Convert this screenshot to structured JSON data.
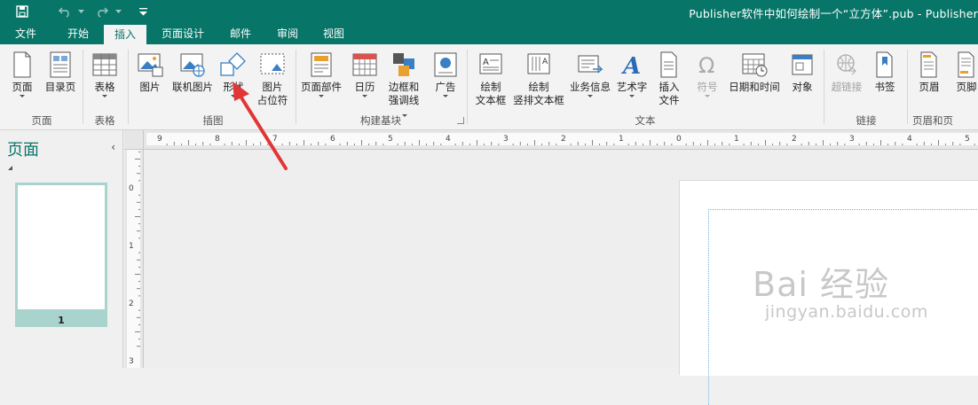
{
  "window": {
    "title": "Publisher软件中如何绘制一个“立方体”.pub - Publisher"
  },
  "tabs": [
    {
      "label": "文件"
    },
    {
      "label": "开始"
    },
    {
      "label": "插入"
    },
    {
      "label": "页面设计"
    },
    {
      "label": "邮件"
    },
    {
      "label": "审阅"
    },
    {
      "label": "视图"
    }
  ],
  "ribbon": {
    "pages": {
      "page_button": "页面",
      "catalog_page": "目录页",
      "group": "页面"
    },
    "tables": {
      "table_button": "表格",
      "group": "表格"
    },
    "illustrations": {
      "picture": "图片",
      "online_picture": "联机图片",
      "shapes": "形状",
      "placeholder_l1": "图片",
      "placeholder_l2": "占位符",
      "group": "插图"
    },
    "building_blocks": {
      "page_parts": "页面部件",
      "calendar": "日历",
      "borders_l1": "边框和",
      "borders_l2": "强调线",
      "ads": "广告",
      "group": "构建基块"
    },
    "text": {
      "draw_tb_l1": "绘制",
      "draw_tb_l2": "文本框",
      "draw_vtb_l1": "绘制",
      "draw_vtb_l2": "竖排文本框",
      "business_info": "业务信息",
      "wordart": "艺术字",
      "insert_file_l1": "插入",
      "insert_file_l2": "文件",
      "symbol": "符号",
      "datetime": "日期和时间",
      "object": "对象",
      "group": "文本"
    },
    "links": {
      "hyperlink": "超链接",
      "bookmark": "书签",
      "group": "链接"
    },
    "header_footer": {
      "header": "页眉",
      "footer": "页脚",
      "group": "页眉和页"
    }
  },
  "pages_pane": {
    "title": "页面",
    "page_number": "1"
  },
  "ruler": {
    "h_labels": [
      "9",
      "8",
      "7",
      "6",
      "5",
      "4",
      "3",
      "2",
      "1",
      "0",
      "1",
      "2",
      "3",
      "4",
      "5"
    ],
    "v_labels": [
      "0",
      "1",
      "2",
      "3"
    ]
  },
  "watermark": {
    "brand": "Bai  经验",
    "url": "jingyan.baidu.com"
  },
  "colors": {
    "accent": "#077568",
    "arrow": "#e23535"
  }
}
